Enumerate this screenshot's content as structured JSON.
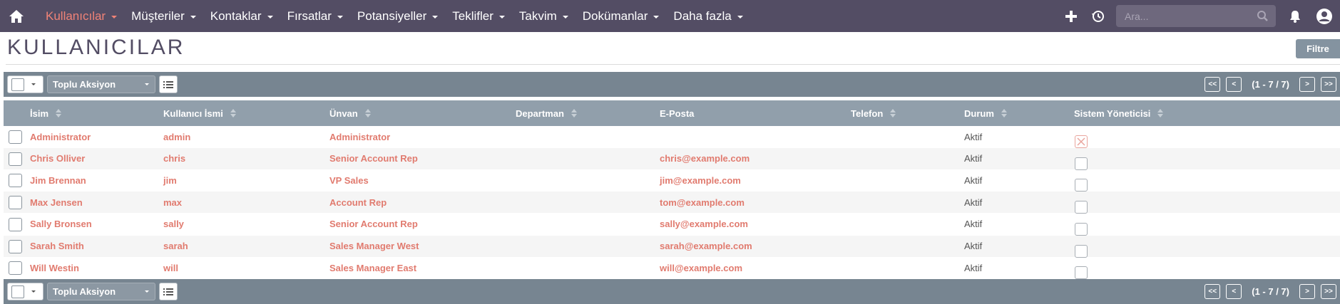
{
  "nav": {
    "items": [
      {
        "label": "Kullanıcılar",
        "active": true
      },
      {
        "label": "Müşteriler"
      },
      {
        "label": "Kontaklar"
      },
      {
        "label": "Fırsatlar"
      },
      {
        "label": "Potansiyeller"
      },
      {
        "label": "Teklifler"
      },
      {
        "label": "Takvim"
      },
      {
        "label": "Dokümanlar"
      },
      {
        "label": "Daha fazla"
      }
    ],
    "search_placeholder": "Ara...",
    "icons": [
      "home-icon",
      "plus-icon",
      "history-icon",
      "search-icon",
      "bell-icon",
      "user-icon"
    ]
  },
  "page": {
    "title": "KULLANICILAR",
    "filter_label": "Filtre"
  },
  "toolbar": {
    "bulk_action_label": "Toplu Aksiyon",
    "pager": {
      "first": "<<",
      "prev": "<",
      "info": "(1 - 7 / 7)",
      "next": ">",
      "last": ">>"
    }
  },
  "table": {
    "columns": [
      "İsim",
      "Kullanıcı İsmi",
      "Ünvan",
      "Departman",
      "E-Posta",
      "Telefon",
      "Durum",
      "Sistem Yöneticisi"
    ],
    "rows": [
      {
        "name": "Administrator",
        "username": "admin",
        "title": "Administrator",
        "department": "",
        "email": "",
        "phone": "",
        "status": "Aktif",
        "is_admin": true
      },
      {
        "name": "Chris Olliver",
        "username": "chris",
        "title": "Senior Account Rep",
        "department": "",
        "email": "chris@example.com",
        "phone": "",
        "status": "Aktif",
        "is_admin": false
      },
      {
        "name": "Jim Brennan",
        "username": "jim",
        "title": "VP Sales",
        "department": "",
        "email": "jim@example.com",
        "phone": "",
        "status": "Aktif",
        "is_admin": false
      },
      {
        "name": "Max Jensen",
        "username": "max",
        "title": "Account Rep",
        "department": "",
        "email": "tom@example.com",
        "phone": "",
        "status": "Aktif",
        "is_admin": false
      },
      {
        "name": "Sally Bronsen",
        "username": "sally",
        "title": "Senior Account Rep",
        "department": "",
        "email": "sally@example.com",
        "phone": "",
        "status": "Aktif",
        "is_admin": false
      },
      {
        "name": "Sarah Smith",
        "username": "sarah",
        "title": "Sales Manager West",
        "department": "",
        "email": "sarah@example.com",
        "phone": "",
        "status": "Aktif",
        "is_admin": false
      },
      {
        "name": "Will Westin",
        "username": "will",
        "title": "Sales Manager East",
        "department": "",
        "email": "will@example.com",
        "phone": "",
        "status": "Aktif",
        "is_admin": false
      }
    ]
  },
  "colors": {
    "navbar": "#534d64",
    "accent": "#f08377",
    "link": "#e17b6f",
    "toolbar": "#778591",
    "table_header": "#919fab"
  }
}
